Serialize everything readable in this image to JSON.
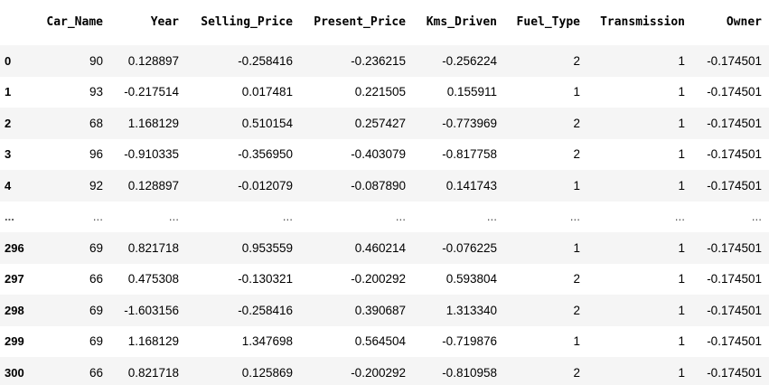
{
  "table": {
    "index_header": "",
    "columns": [
      "Car_Name",
      "Year",
      "Selling_Price",
      "Present_Price",
      "Kms_Driven",
      "Fuel_Type",
      "Transmission",
      "Owner"
    ],
    "rows": [
      {
        "index": "0",
        "cells": [
          "90",
          "0.128897",
          "-0.258416",
          "-0.236215",
          "-0.256224",
          "2",
          "1",
          "-0.174501"
        ]
      },
      {
        "index": "1",
        "cells": [
          "93",
          "-0.217514",
          "0.017481",
          "0.221505",
          "0.155911",
          "1",
          "1",
          "-0.174501"
        ]
      },
      {
        "index": "2",
        "cells": [
          "68",
          "1.168129",
          "0.510154",
          "0.257427",
          "-0.773969",
          "2",
          "1",
          "-0.174501"
        ]
      },
      {
        "index": "3",
        "cells": [
          "96",
          "-0.910335",
          "-0.356950",
          "-0.403079",
          "-0.817758",
          "2",
          "1",
          "-0.174501"
        ]
      },
      {
        "index": "4",
        "cells": [
          "92",
          "0.128897",
          "-0.012079",
          "-0.087890",
          "0.141743",
          "1",
          "1",
          "-0.174501"
        ]
      },
      {
        "index": "...",
        "cells": [
          "...",
          "...",
          "...",
          "...",
          "...",
          "...",
          "...",
          "..."
        ]
      },
      {
        "index": "296",
        "cells": [
          "69",
          "0.821718",
          "0.953559",
          "0.460214",
          "-0.076225",
          "1",
          "1",
          "-0.174501"
        ]
      },
      {
        "index": "297",
        "cells": [
          "66",
          "0.475308",
          "-0.130321",
          "-0.200292",
          "0.593804",
          "2",
          "1",
          "-0.174501"
        ]
      },
      {
        "index": "298",
        "cells": [
          "69",
          "-1.603156",
          "-0.258416",
          "0.390687",
          "1.313340",
          "2",
          "1",
          "-0.174501"
        ]
      },
      {
        "index": "299",
        "cells": [
          "69",
          "1.168129",
          "1.347698",
          "0.564504",
          "-0.719876",
          "1",
          "1",
          "-0.174501"
        ]
      },
      {
        "index": "300",
        "cells": [
          "66",
          "0.821718",
          "0.125869",
          "-0.200292",
          "-0.810958",
          "2",
          "1",
          "-0.174501"
        ]
      }
    ]
  },
  "colors": {
    "row_stripe": "#f5f5f5",
    "background": "#ffffff",
    "text": "#000000"
  }
}
